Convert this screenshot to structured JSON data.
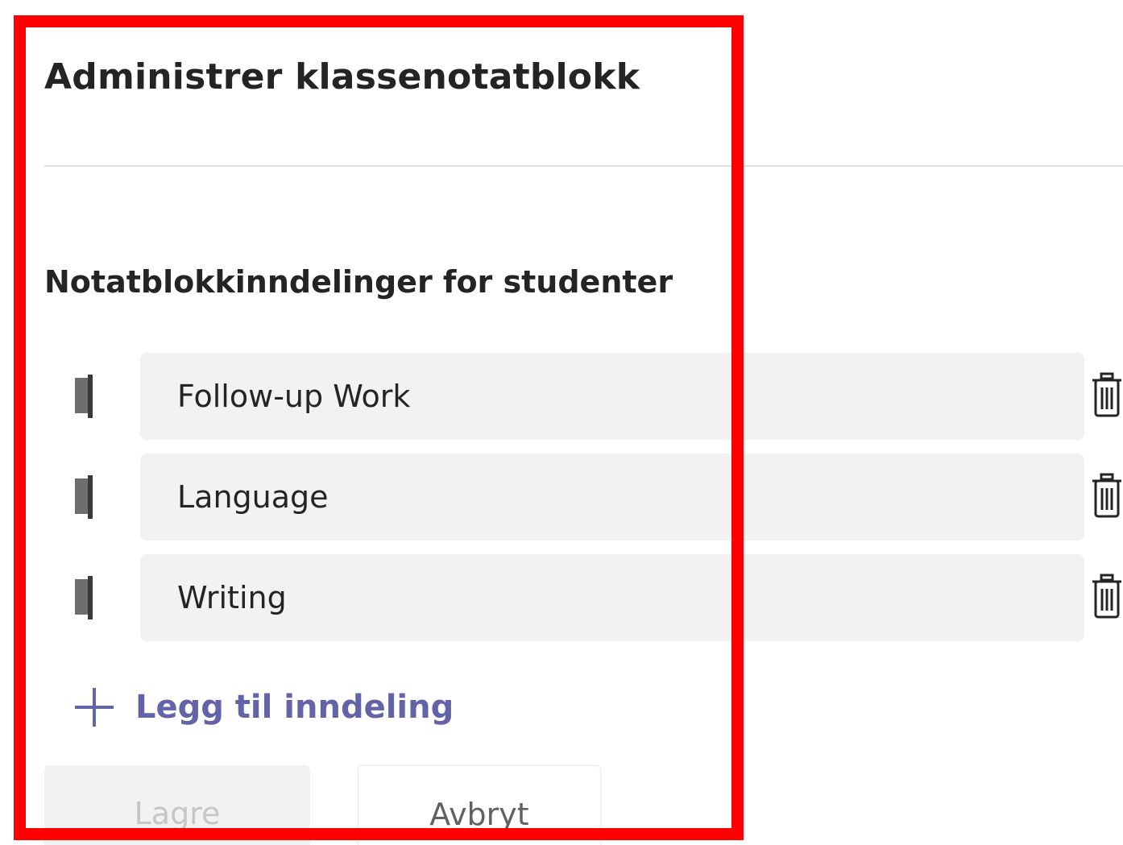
{
  "dialog": {
    "title": "Administrer klassenotatblokk"
  },
  "sections_panel": {
    "heading": "Notatblokkinndelinger for studenter",
    "sections": [
      {
        "value": "Follow-up Work"
      },
      {
        "value": "Language"
      },
      {
        "value": "Writing"
      }
    ],
    "add_section_label": "Legg til inndeling"
  },
  "footer": {
    "save_label": "Lagre",
    "cancel_label": "Avbryt"
  },
  "icons": {
    "drag_handle": "drag-handle-icon",
    "delete": "trash-icon",
    "add": "plus-icon"
  },
  "colors": {
    "accent": "#6264a7",
    "highlight": "#ff0000",
    "input_background": "#f3f2f1",
    "text": "#252423"
  }
}
